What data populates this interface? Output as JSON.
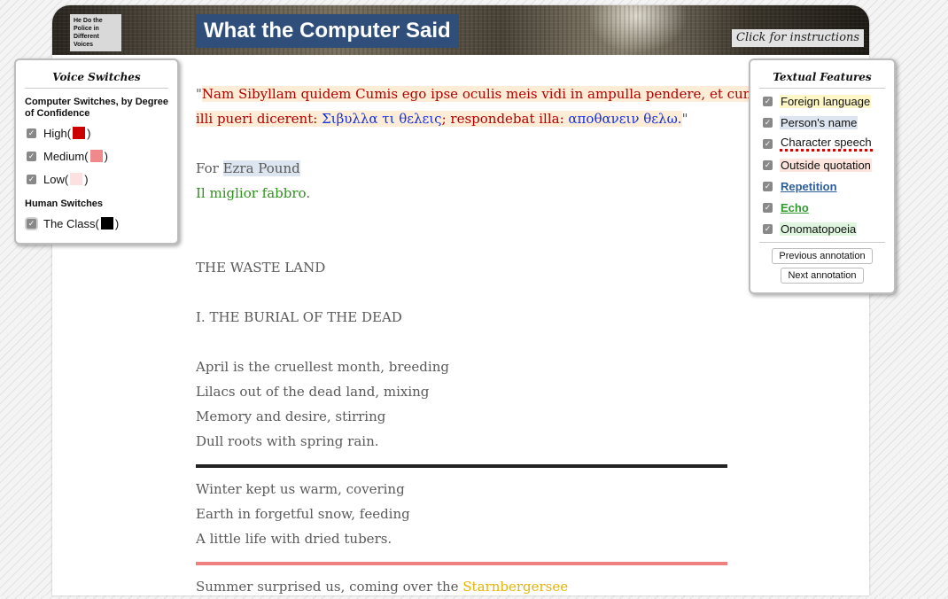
{
  "header": {
    "logo_text": "He Do the Police in Different Voices",
    "title": "What the Computer Said",
    "instructions": "Click for instructions"
  },
  "voice_switches": {
    "title": "Voice Switches",
    "computer_heading": "Computer Switches, by Degree of Confidence",
    "levels": [
      {
        "label": "High",
        "color": "#cc0000"
      },
      {
        "label": "Medium",
        "color": "#f08a8a"
      },
      {
        "label": "Low",
        "color": "#fde0e0"
      }
    ],
    "human_heading": "Human Switches",
    "human": [
      {
        "label": "The Class",
        "color": "#000000"
      }
    ]
  },
  "textual_features": {
    "title": "Textual Features",
    "items": [
      {
        "label": "Foreign language",
        "style": "foreign"
      },
      {
        "label": "Person's name",
        "style": "name"
      },
      {
        "label": "Character speech",
        "style": "speech"
      },
      {
        "label": "Outside quotation",
        "style": "outside"
      },
      {
        "label": "Repetition",
        "style": "repetition"
      },
      {
        "label": "Echo",
        "style": "echo"
      },
      {
        "label": "Onomatopoeia",
        "style": "onomatopoeia"
      }
    ],
    "prev_button": "Previous annotation",
    "next_button": "Next annotation"
  },
  "text": {
    "epigraph_q1": "\"",
    "epigraph_latin_1": "Nam Sibyllam quidem Cumis ego ipse oculis meis vidi in ampulla pendere, et cum",
    "epigraph_latin_2": "illi pueri dicerent: ",
    "epigraph_greek_1": "Σιβυλλα τι θελεις",
    "epigraph_latin_3": "; respondebat illa: ",
    "epigraph_greek_2": "αποθανειν θελω.",
    "epigraph_q2": "\"",
    "for_prefix": "For ",
    "for_name": "Ezra Pound",
    "fabbro": "Il miglior fabbro",
    "fabbro_end": ".",
    "poem_title": "THE WASTE LAND",
    "section_title": "I. THE BURIAL OF THE DEAD",
    "stanza1": [
      "April is the cruellest month, breeding",
      "Lilacs out of the dead land, mixing",
      "Memory and desire, stirring",
      "Dull roots with spring rain."
    ],
    "rule1_color": "#222222",
    "stanza2": [
      "Winter kept us warm, covering",
      "Earth in forgetful snow, feeding",
      "A little life with dried tubers."
    ],
    "rule2_color": "#ee8080",
    "summer_prefix": "Summer surprised us, coming over the ",
    "summer_place": "Starnbergersee"
  }
}
